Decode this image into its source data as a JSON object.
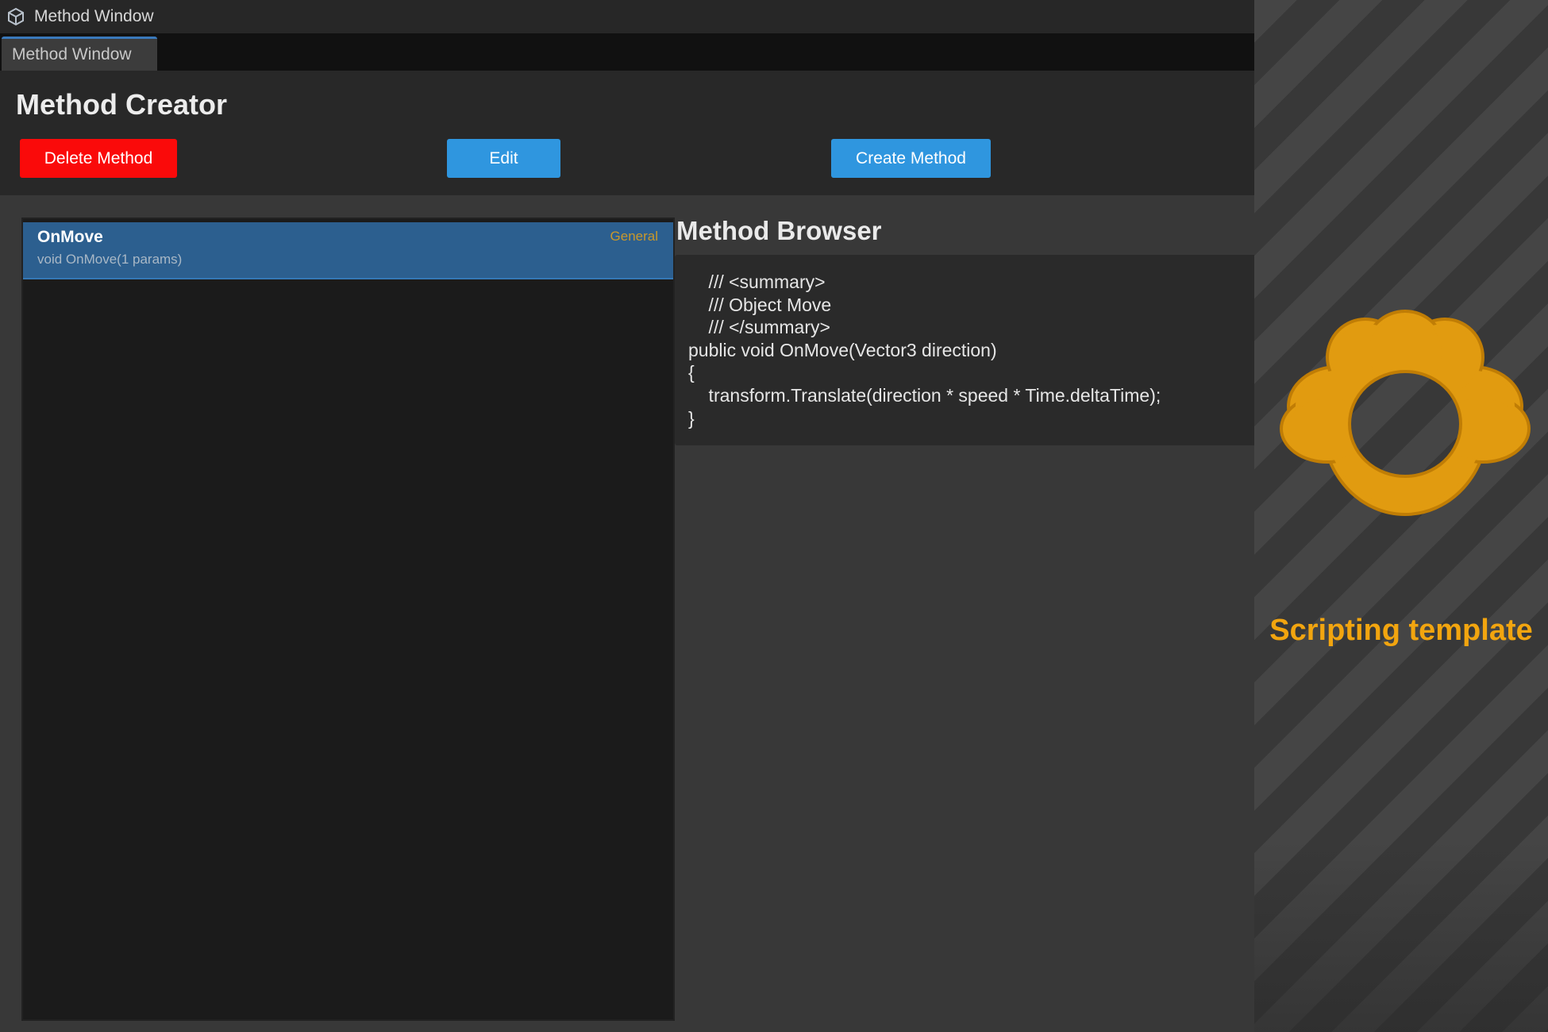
{
  "window": {
    "title": "Method Window",
    "icon": "unity-cube-icon"
  },
  "tabs": [
    {
      "label": "Method Window",
      "active": true
    }
  ],
  "header": {
    "title": "Method Creator",
    "buttons": {
      "delete_label": "Delete Method",
      "edit_label": "Edit",
      "create_label": "Create Method"
    }
  },
  "methods": [
    {
      "name": "OnMove",
      "signature": "void OnMove(1 params)",
      "category": "General",
      "selected": true
    }
  ],
  "browser": {
    "title": "Method Browser",
    "code_lines": [
      "    /// <summary>",
      "    /// Object Move",
      "    /// </summary>",
      "public void OnMove(Vector3 direction)",
      "{",
      "    transform.Translate(direction * speed * Time.deltaTime);",
      "}"
    ]
  },
  "side_panel": {
    "caption": "Scripting template",
    "logo_icon": "flower-logo-icon"
  },
  "colors": {
    "delete_button": "#fa0a0a",
    "primary_button": "#2f96df",
    "selected_row": "#2c5f8f",
    "category_text": "#c9982b",
    "brand_orange": "#f2a50f"
  }
}
